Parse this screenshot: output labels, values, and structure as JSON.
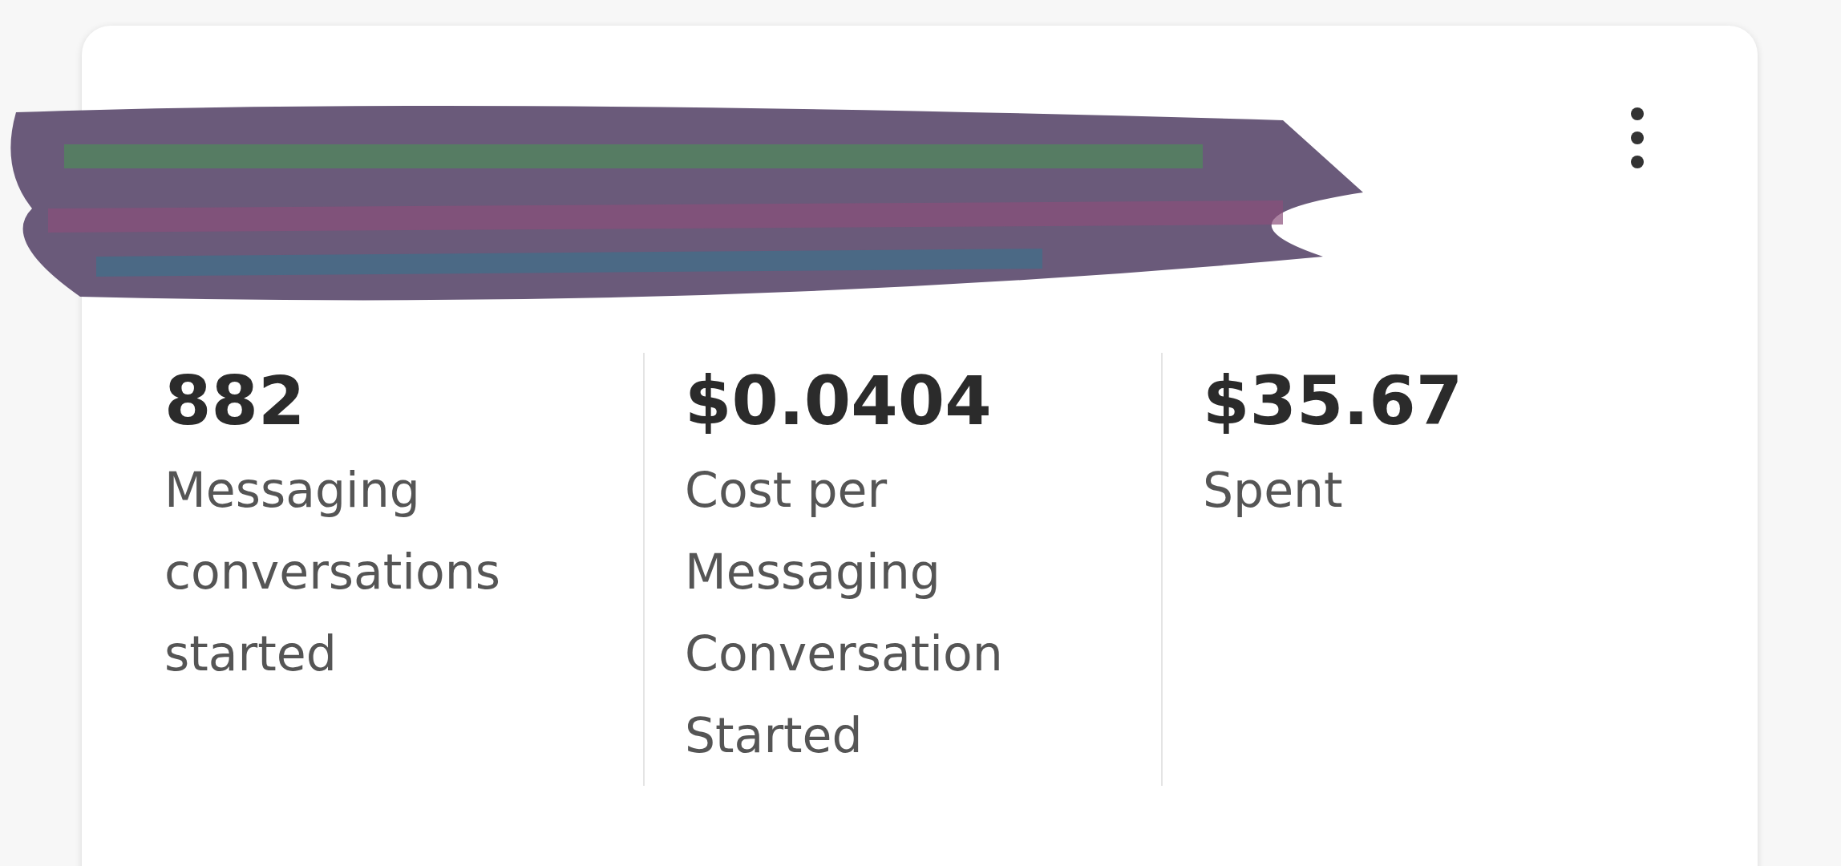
{
  "metrics": [
    {
      "value": "882",
      "label": "Messaging conversations started"
    },
    {
      "value": "$0.0404",
      "label": "Cost per Messaging Conversation Started"
    },
    {
      "value": "$35.67",
      "label": "Spent"
    }
  ]
}
